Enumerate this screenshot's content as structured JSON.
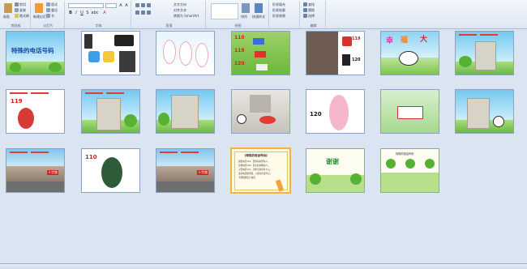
{
  "ribbon": {
    "groups": [
      {
        "label": "剪贴板",
        "items": [
          "粘贴",
          "剪切",
          "复制",
          "格式刷"
        ]
      },
      {
        "label": "幻灯片",
        "items": [
          "新建幻灯片",
          "版式",
          "重设",
          "节"
        ]
      },
      {
        "label": "字体",
        "items": [
          "B",
          "I",
          "U",
          "S",
          "abc",
          "A"
        ]
      },
      {
        "label": "段落",
        "items": [
          "文字方向",
          "对齐文本",
          "转换为 SmartArt"
        ]
      },
      {
        "label": "绘图",
        "items": [
          "排列",
          "快速样式"
        ]
      },
      {
        "label": "",
        "items": [
          "形状填充",
          "形状轮廓",
          "形状效果"
        ]
      },
      {
        "label": "编辑",
        "items": [
          "查找",
          "替换",
          "选择"
        ]
      }
    ]
  },
  "slides": {
    "title_slide_text": "特殊的电话号码",
    "num_119": "119",
    "num_120": "120",
    "num_110": "110",
    "num_119b": "119",
    "num_120b": "120",
    "num_120c": "120",
    "num_110b": "110",
    "xiexie": "谢谢",
    "happy_chars": [
      "幸",
      "福",
      "大"
    ],
    "sign_text": "十字路",
    "poem_title": "《特殊的电话号码》",
    "poem_lines": [
      "遇警电话110，警察叔叔帮助人。",
      "急救电话120，医生叔叔救病人。",
      "火警电话119，消防员叔叔扑大火。",
      "这些电话很重要，小朋友们要牢记。",
      "不能随便乱打电话。"
    ],
    "summary_title": "特殊的电话号码"
  }
}
